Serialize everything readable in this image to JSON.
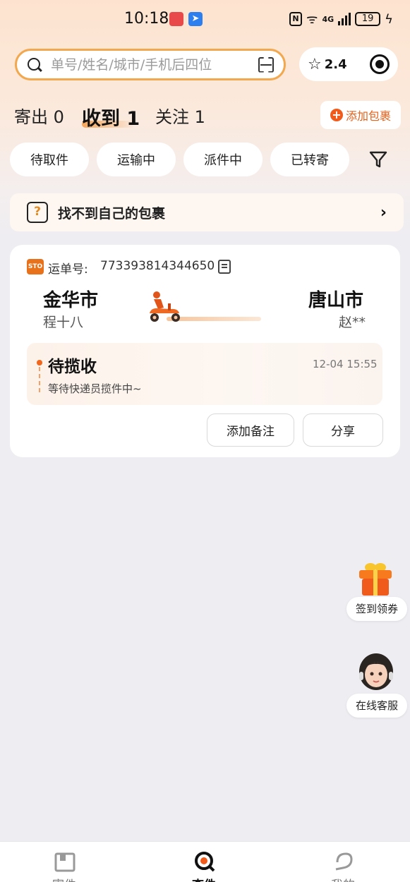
{
  "status_bar": {
    "time": "10:18",
    "network": "4G",
    "battery": "19"
  },
  "search": {
    "placeholder": "单号/姓名/城市/手机后四位"
  },
  "rating": {
    "value": "2.4"
  },
  "tabs": [
    {
      "label": "寄出 0"
    },
    {
      "label": "收到 1"
    },
    {
      "label": "关注 1"
    }
  ],
  "add_package_label": "添加包裹",
  "filters": [
    "待取件",
    "运输中",
    "派件中",
    "已转寄"
  ],
  "help": {
    "label": "找不到自己的包裹"
  },
  "package": {
    "courier_logo": "STO",
    "waybill_label": "运单号:",
    "waybill_number": "773393814344650",
    "from_city": "金华市",
    "from_name": "程十八",
    "to_city": "唐山市",
    "to_name": "赵**",
    "status_title": "待揽收",
    "status_time": "12-04 15:55",
    "status_desc": "等待快递员揽件中~",
    "buttons": {
      "add_note": "添加备注",
      "share": "分享"
    }
  },
  "floating": {
    "signin_label": "签到领券",
    "service_label": "在线客服"
  },
  "bottom_nav": [
    {
      "label": "寄件"
    },
    {
      "label": "查件"
    },
    {
      "label": "我的"
    }
  ],
  "colors": {
    "accent": "#f05a1a",
    "search_border": "#f2a84f"
  }
}
